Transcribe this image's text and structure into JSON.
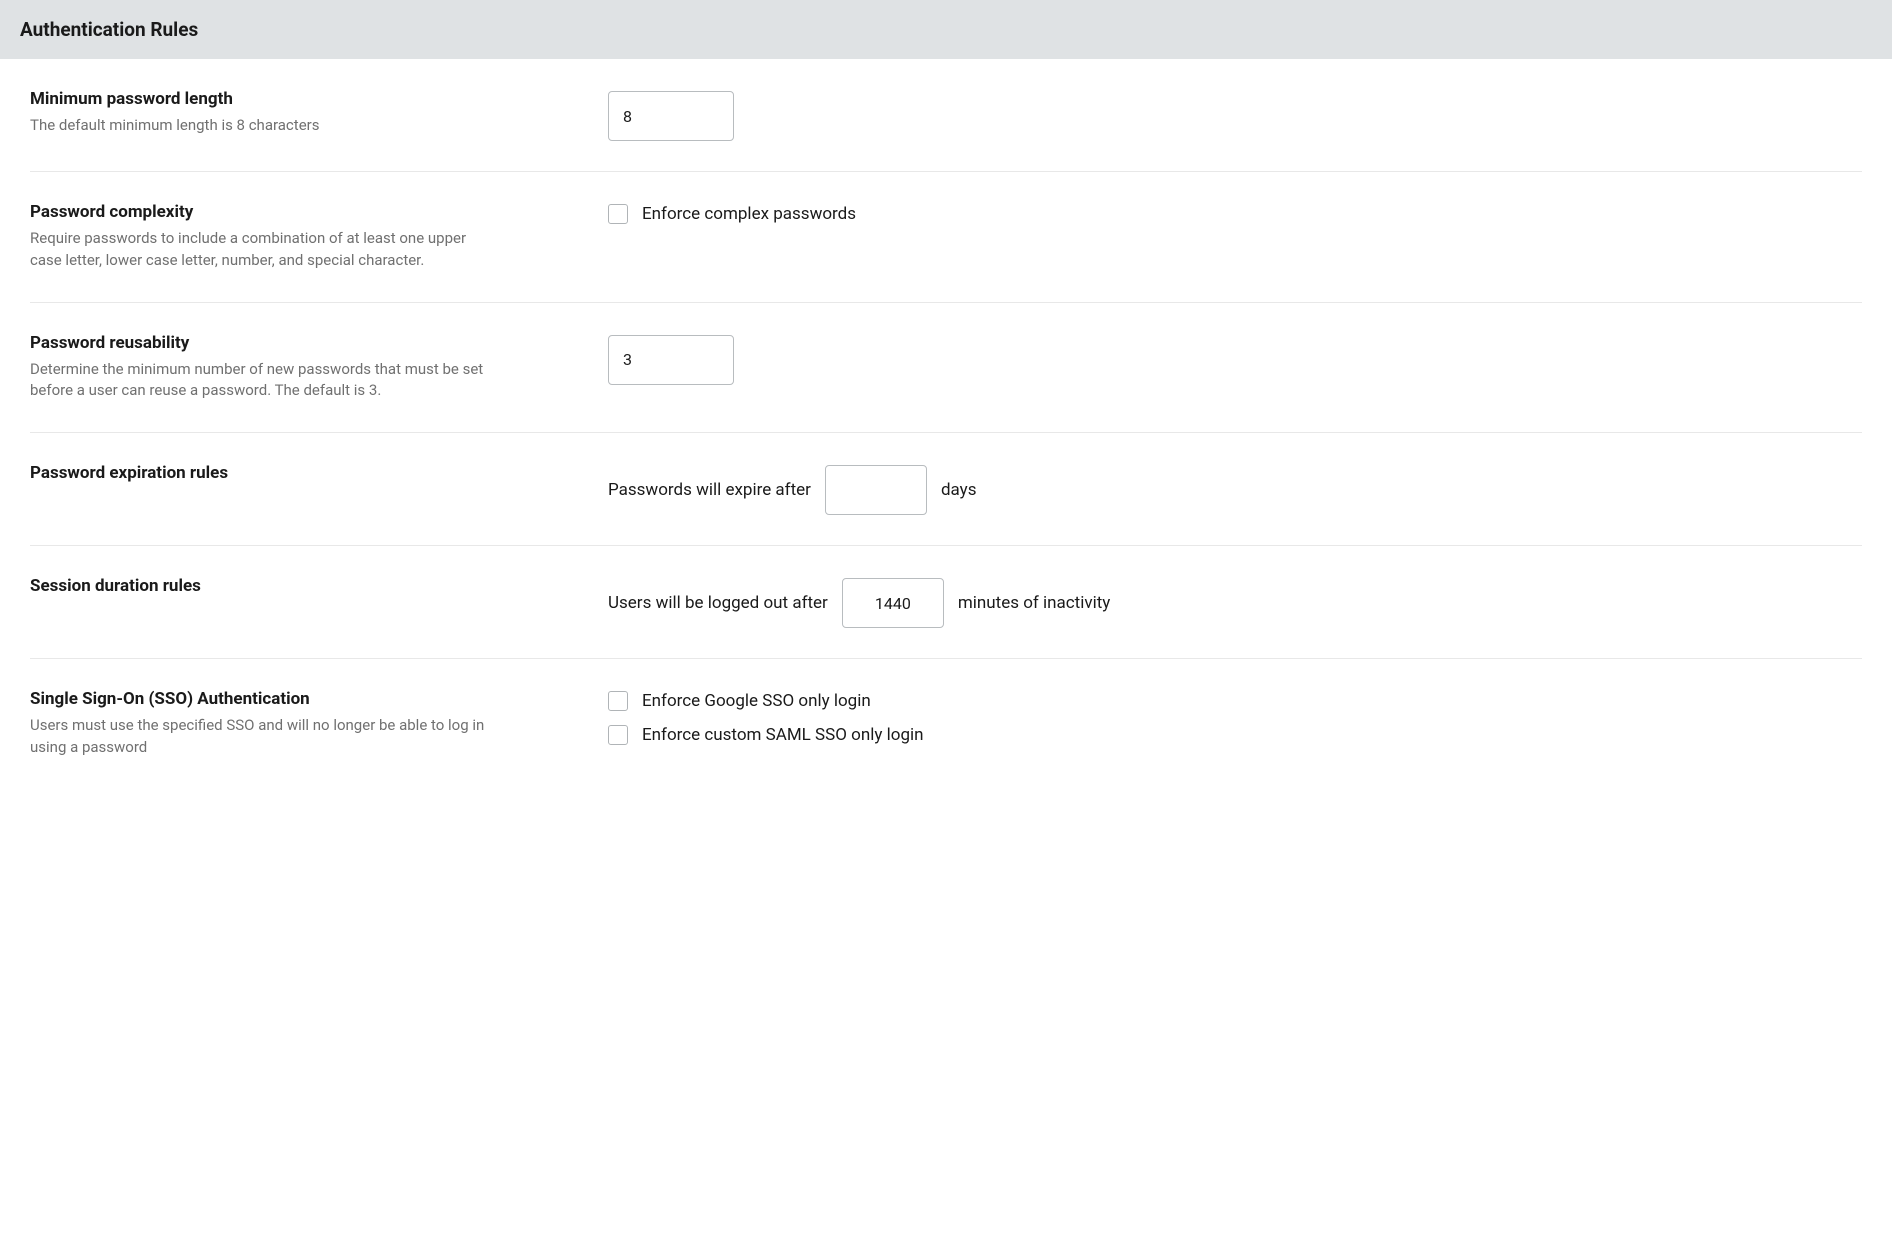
{
  "header": {
    "title": "Authentication Rules"
  },
  "sections": {
    "min_password": {
      "title": "Minimum password length",
      "desc": "The default minimum length is 8 characters",
      "value": "8"
    },
    "complexity": {
      "title": "Password complexity",
      "desc": "Require passwords to include a combination of at least one upper case letter, lower case letter, number, and special character.",
      "checkbox_label": "Enforce complex passwords"
    },
    "reusability": {
      "title": "Password reusability",
      "desc": "Determine the minimum number of new passwords that must be set before a user can reuse a password. The default is 3.",
      "value": "3"
    },
    "expiration": {
      "title": "Password expiration rules",
      "prefix": "Passwords will expire after",
      "value": "",
      "suffix": "days"
    },
    "session": {
      "title": "Session duration rules",
      "prefix": "Users will be logged out after",
      "value": "1440",
      "suffix": "minutes of inactivity"
    },
    "sso": {
      "title": "Single Sign-On (SSO) Authentication",
      "desc": "Users must use the specified SSO and will no longer be able to log in using a password",
      "google_label": "Enforce Google SSO only login",
      "saml_label": "Enforce custom SAML SSO only login"
    }
  }
}
